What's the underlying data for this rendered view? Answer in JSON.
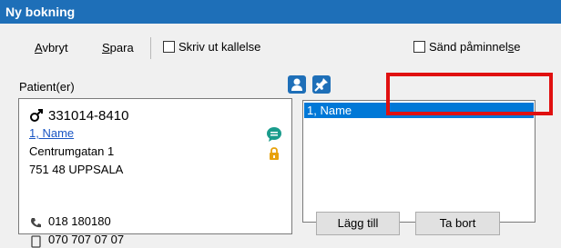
{
  "window": {
    "title": "Ny bokning"
  },
  "toolbar": {
    "cancel_prefix": "",
    "cancel_accel": "A",
    "cancel_rest": "vbryt",
    "save_prefix": "",
    "save_accel": "S",
    "save_rest": "para",
    "print_label": "Skriv ut kallelse",
    "reminder_prefix": "Sänd påminnel",
    "reminder_accel": "s",
    "reminder_rest": "e"
  },
  "patients": {
    "label": "Patient(er)",
    "id": "331014-8410",
    "name_link": "1, Name",
    "street": "Centrumgatan 1",
    "city": "751 48 UPPSALA",
    "phone": "018 180180",
    "mobile": "070 707 07 07"
  },
  "list": {
    "items": [
      "1, Name"
    ]
  },
  "buttons": {
    "add": "Lägg till",
    "remove": "Ta bort"
  },
  "colors": {
    "titlebar": "#1e6fb8",
    "selection": "#0078d7",
    "link": "#1a56c4",
    "highlight": "#e01010",
    "chat_icon": "#1a9c8c",
    "lock_icon": "#e8a20c"
  }
}
